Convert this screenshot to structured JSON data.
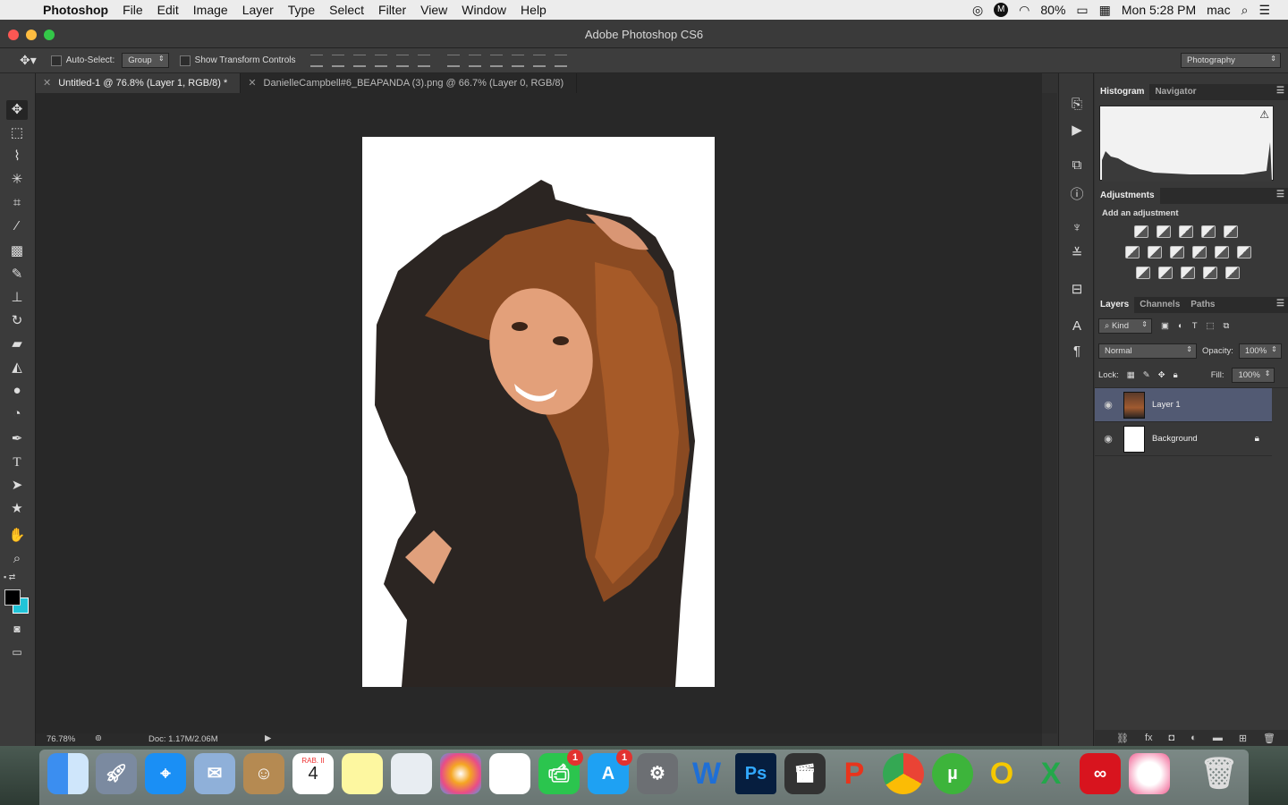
{
  "menubar": {
    "app": "Photoshop",
    "items": [
      "File",
      "Edit",
      "Image",
      "Layer",
      "Type",
      "Select",
      "Filter",
      "View",
      "Window",
      "Help"
    ],
    "battery": "80%",
    "clock": "Mon 5:28 PM",
    "user": "mac"
  },
  "window": {
    "title": "Adobe Photoshop CS6"
  },
  "options": {
    "auto_select_label": "Auto-Select:",
    "auto_select_value": "Group",
    "transform_label": "Show Transform Controls",
    "workspace": "Photography"
  },
  "tabs": [
    {
      "label": "Untitled-1 @ 76.8% (Layer 1, RGB/8) *"
    },
    {
      "label": "DanielleCampbell#6_BEAPANDA (3).png @ 66.7% (Layer 0, RGB/8)"
    }
  ],
  "status": {
    "zoom": "76.78%",
    "doc": "Doc: 1.17M/2.06M"
  },
  "panels": {
    "histogram_tab": "Histogram",
    "navigator_tab": "Navigator",
    "adjustments_tab": "Adjustments",
    "adjustments_label": "Add an adjustment",
    "layers_tab": "Layers",
    "channels_tab": "Channels",
    "paths_tab": "Paths",
    "kind": "Kind",
    "blend": "Normal",
    "opacity_label": "Opacity:",
    "opacity": "100%",
    "lock_label": "Lock:",
    "fill_label": "Fill:",
    "fill": "100%",
    "layers": [
      {
        "name": "Layer 1"
      },
      {
        "name": "Background"
      }
    ]
  },
  "colors": {
    "foreground": "#000000",
    "background": "#20c4d8",
    "selected_layer": "#525a73"
  },
  "dock": {
    "calendar_month": "RAB. II",
    "calendar_day": "4",
    "facetime_badge": "1",
    "appstore_badge": "1",
    "ps": "Ps"
  }
}
